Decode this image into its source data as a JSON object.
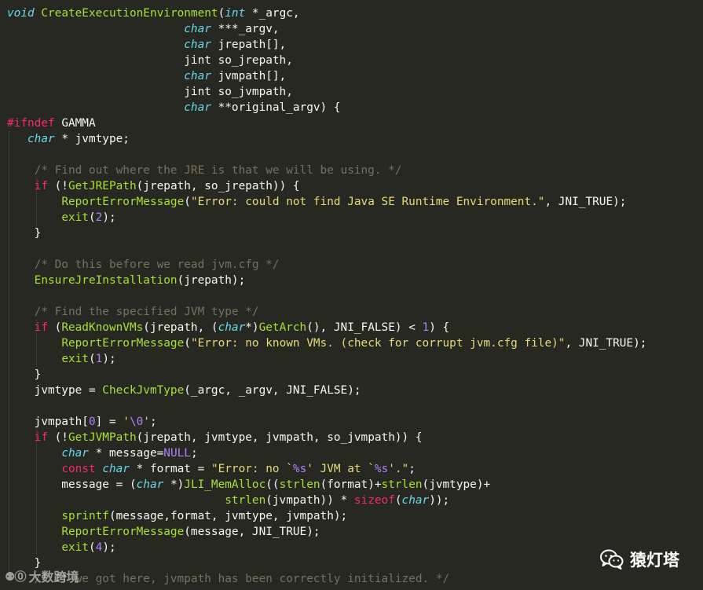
{
  "lines": [
    [
      [
        "tok-type",
        "void"
      ],
      [
        "tok-pl",
        " "
      ],
      [
        "tok-fname",
        "CreateExecutionEnvironment"
      ],
      [
        "tok-pl",
        "("
      ],
      [
        "tok-type",
        "int"
      ],
      [
        "tok-pl",
        " *_argc,"
      ]
    ],
    [
      [
        "tok-pl",
        "                          "
      ],
      [
        "tok-type",
        "char"
      ],
      [
        "tok-pl",
        " ***_argv,"
      ]
    ],
    [
      [
        "tok-pl",
        "                          "
      ],
      [
        "tok-type",
        "char"
      ],
      [
        "tok-pl",
        " jrepath[],"
      ]
    ],
    [
      [
        "tok-pl",
        "                          jint so_jrepath,"
      ]
    ],
    [
      [
        "tok-pl",
        "                          "
      ],
      [
        "tok-type",
        "char"
      ],
      [
        "tok-pl",
        " jvmpath[],"
      ]
    ],
    [
      [
        "tok-pl",
        "                          jint so_jvmpath,"
      ]
    ],
    [
      [
        "tok-pl",
        "                          "
      ],
      [
        "tok-type",
        "char"
      ],
      [
        "tok-pl",
        " **original_argv) {"
      ]
    ],
    [
      [
        "tok-kw",
        "#ifndef"
      ],
      [
        "tok-pl",
        " GAMMA"
      ]
    ],
    [
      [
        "tok-pl",
        "   "
      ],
      [
        "tok-type",
        "char"
      ],
      [
        "tok-pl",
        " * jvmtype;"
      ]
    ],
    [],
    [
      [
        "tok-pl",
        "    "
      ],
      [
        "tok-com",
        "/* Find out where the JRE is that we will be using. */"
      ]
    ],
    [
      [
        "tok-pl",
        "    "
      ],
      [
        "tok-kw",
        "if"
      ],
      [
        "tok-pl",
        " (!"
      ],
      [
        "tok-fn",
        "GetJREPath"
      ],
      [
        "tok-pl",
        "(jrepath, so_jrepath)) {"
      ]
    ],
    [
      [
        "tok-pl",
        "        "
      ],
      [
        "tok-fn",
        "ReportErrorMessage"
      ],
      [
        "tok-pl",
        "("
      ],
      [
        "tok-str",
        "\"Error: could not find Java SE Runtime Environment.\""
      ],
      [
        "tok-pl",
        ", JNI_TRUE);"
      ]
    ],
    [
      [
        "tok-pl",
        "        "
      ],
      [
        "tok-fn",
        "exit"
      ],
      [
        "tok-pl",
        "("
      ],
      [
        "tok-num",
        "2"
      ],
      [
        "tok-pl",
        ");"
      ]
    ],
    [
      [
        "tok-pl",
        "    }"
      ]
    ],
    [],
    [
      [
        "tok-pl",
        "    "
      ],
      [
        "tok-com",
        "/* Do this before we read jvm.cfg */"
      ]
    ],
    [
      [
        "tok-pl",
        "    "
      ],
      [
        "tok-fn",
        "EnsureJreInstallation"
      ],
      [
        "tok-pl",
        "(jrepath);"
      ]
    ],
    [],
    [
      [
        "tok-pl",
        "    "
      ],
      [
        "tok-com",
        "/* Find the specified JVM type */"
      ]
    ],
    [
      [
        "tok-pl",
        "    "
      ],
      [
        "tok-kw",
        "if"
      ],
      [
        "tok-pl",
        " ("
      ],
      [
        "tok-fn",
        "ReadKnownVMs"
      ],
      [
        "tok-pl",
        "(jrepath, ("
      ],
      [
        "tok-type",
        "char"
      ],
      [
        "tok-pl",
        "*)"
      ],
      [
        "tok-fn",
        "GetArch"
      ],
      [
        "tok-pl",
        "(), JNI_FALSE) < "
      ],
      [
        "tok-num",
        "1"
      ],
      [
        "tok-pl",
        ") {"
      ]
    ],
    [
      [
        "tok-pl",
        "        "
      ],
      [
        "tok-fn",
        "ReportErrorMessage"
      ],
      [
        "tok-pl",
        "("
      ],
      [
        "tok-str",
        "\"Error: no known VMs. (check for corrupt jvm.cfg file)\""
      ],
      [
        "tok-pl",
        ", JNI_TRUE);"
      ]
    ],
    [
      [
        "tok-pl",
        "        "
      ],
      [
        "tok-fn",
        "exit"
      ],
      [
        "tok-pl",
        "("
      ],
      [
        "tok-num",
        "1"
      ],
      [
        "tok-pl",
        ");"
      ]
    ],
    [
      [
        "tok-pl",
        "    }"
      ]
    ],
    [
      [
        "tok-pl",
        "    jvmtype = "
      ],
      [
        "tok-fn",
        "CheckJvmType"
      ],
      [
        "tok-pl",
        "(_argc, _argv, JNI_FALSE);"
      ]
    ],
    [],
    [
      [
        "tok-pl",
        "    jvmpath["
      ],
      [
        "tok-num",
        "0"
      ],
      [
        "tok-pl",
        "] = "
      ],
      [
        "tok-str",
        "'"
      ],
      [
        "tok-esc",
        "\\0"
      ],
      [
        "tok-str",
        "'"
      ],
      [
        "tok-pl",
        ";"
      ]
    ],
    [
      [
        "tok-pl",
        "    "
      ],
      [
        "tok-kw",
        "if"
      ],
      [
        "tok-pl",
        " (!"
      ],
      [
        "tok-fn",
        "GetJVMPath"
      ],
      [
        "tok-pl",
        "(jrepath, jvmtype, jvmpath, so_jvmpath)) {"
      ]
    ],
    [
      [
        "tok-pl",
        "        "
      ],
      [
        "tok-type",
        "char"
      ],
      [
        "tok-pl",
        " * message="
      ],
      [
        "tok-num",
        "NULL"
      ],
      [
        "tok-pl",
        ";"
      ]
    ],
    [
      [
        "tok-pl",
        "        "
      ],
      [
        "tok-kw",
        "const"
      ],
      [
        "tok-pl",
        " "
      ],
      [
        "tok-type",
        "char"
      ],
      [
        "tok-pl",
        " * format = "
      ],
      [
        "tok-str",
        "\"Error: no `"
      ],
      [
        "tok-esc",
        "%s"
      ],
      [
        "tok-str",
        "' JVM at `"
      ],
      [
        "tok-esc",
        "%s"
      ],
      [
        "tok-str",
        "'.\""
      ],
      [
        "tok-pl",
        ";"
      ]
    ],
    [
      [
        "tok-pl",
        "        message = ("
      ],
      [
        "tok-type",
        "char"
      ],
      [
        "tok-pl",
        " *)"
      ],
      [
        "tok-fn",
        "JLI_MemAlloc"
      ],
      [
        "tok-pl",
        "(("
      ],
      [
        "tok-fn",
        "strlen"
      ],
      [
        "tok-pl",
        "(format)+"
      ],
      [
        "tok-fn",
        "strlen"
      ],
      [
        "tok-pl",
        "(jvmtype)+"
      ]
    ],
    [
      [
        "tok-pl",
        "                                "
      ],
      [
        "tok-fn",
        "strlen"
      ],
      [
        "tok-pl",
        "(jvmpath)) * "
      ],
      [
        "tok-kw",
        "sizeof"
      ],
      [
        "tok-pl",
        "("
      ],
      [
        "tok-type",
        "char"
      ],
      [
        "tok-pl",
        "));"
      ]
    ],
    [
      [
        "tok-pl",
        "        "
      ],
      [
        "tok-fn",
        "sprintf"
      ],
      [
        "tok-pl",
        "(message,format, jvmtype, jvmpath);"
      ]
    ],
    [
      [
        "tok-pl",
        "        "
      ],
      [
        "tok-fn",
        "ReportErrorMessage"
      ],
      [
        "tok-pl",
        "(message, JNI_TRUE);"
      ]
    ],
    [
      [
        "tok-pl",
        "        "
      ],
      [
        "tok-fn",
        "exit"
      ],
      [
        "tok-pl",
        "("
      ],
      [
        "tok-num",
        "4"
      ],
      [
        "tok-pl",
        ");"
      ]
    ],
    [
      [
        "tok-pl",
        "    }"
      ]
    ],
    [
      [
        "tok-pl",
        "    "
      ],
      [
        "tok-com",
        "/* If we got here, jvmpath has been correctly initialized. */"
      ]
    ]
  ],
  "watermark_left": {
    "logo": "⚉⓪",
    "text": "大数跨境"
  },
  "watermark_right": {
    "icon": "wechat-icon",
    "text": "猿灯塔"
  },
  "colors": {
    "background": "#272822",
    "keyword": "#f92672",
    "type": "#66d9ef",
    "function": "#a6e22e",
    "string": "#e6db74",
    "number": "#ae81ff",
    "comment": "#75715e",
    "plain": "#f8f8f2"
  }
}
